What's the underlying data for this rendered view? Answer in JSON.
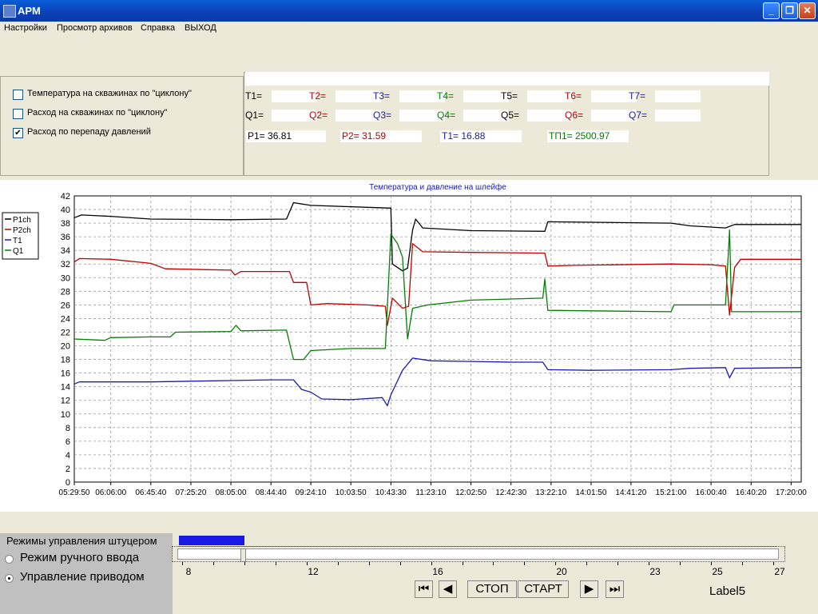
{
  "window": {
    "title": "APM",
    "icon": "app-icon",
    "controls": [
      "minimize-icon",
      "restore-icon",
      "close-icon"
    ]
  },
  "menu": [
    "Настройки",
    "Просмотр архивов",
    "Справка",
    "ВЫХОД"
  ],
  "checkboxes": [
    {
      "label": "Температура на скважинах по \"циклону\"",
      "checked": false
    },
    {
      "label": "Расход на скважинах по \"циклону\"",
      "checked": false
    },
    {
      "label": "Расход по перепаду давлений",
      "checked": true
    }
  ],
  "readings": {
    "row1": [
      {
        "label": "T1=",
        "value": "",
        "color": "#000000"
      },
      {
        "label": "T2=",
        "value": "",
        "color": "#c00000"
      },
      {
        "label": "T3=",
        "value": "",
        "color": "#1a1ab0"
      },
      {
        "label": "T4=",
        "value": "",
        "color": "#008000"
      },
      {
        "label": "T5=",
        "value": "",
        "color": "#000000"
      },
      {
        "label": "T6=",
        "value": "",
        "color": "#c00000"
      },
      {
        "label": "T7=",
        "value": "",
        "color": "#1a1ab0"
      }
    ],
    "row2": [
      {
        "label": "Q1=",
        "value": "",
        "color": "#000000"
      },
      {
        "label": "Q2=",
        "value": "",
        "color": "#c00000"
      },
      {
        "label": "Q3=",
        "value": "",
        "color": "#1a1ab0"
      },
      {
        "label": "Q4=",
        "value": "",
        "color": "#008000"
      },
      {
        "label": "Q5=",
        "value": "",
        "color": "#000000"
      },
      {
        "label": "Q6=",
        "value": "",
        "color": "#c00000"
      },
      {
        "label": "Q7=",
        "value": "",
        "color": "#1a1ab0"
      }
    ],
    "row3": [
      {
        "text": "P1= 36.81",
        "color": "#000000"
      },
      {
        "text": "P2= 31.59",
        "color": "#c00000"
      },
      {
        "text": "T1= 16.88",
        "color": "#1a1ab0"
      },
      {
        "text": "TП1= 2500.97",
        "color": "#008000"
      }
    ]
  },
  "chart_data": {
    "type": "line",
    "title": "Температура и давление на шлейфе",
    "ylim": [
      0,
      42
    ],
    "yticks": [
      0,
      2,
      4,
      6,
      8,
      10,
      12,
      14,
      16,
      18,
      20,
      22,
      24,
      26,
      28,
      30,
      32,
      34,
      36,
      38,
      40,
      42
    ],
    "xticks": [
      "05:29:50",
      "06:06:00",
      "06:45:40",
      "07:25:20",
      "08:05:00",
      "08:44:40",
      "09:24:10",
      "10:03:50",
      "10:43:30",
      "11:23:10",
      "12:02:50",
      "12:42:30",
      "13:22:10",
      "14:01:50",
      "14:41:20",
      "15:21:00",
      "16:00:40",
      "16:40:20",
      "17:20:00"
    ],
    "grid": true,
    "legend_position": "left",
    "series": [
      {
        "name": "P1ch",
        "color": "#000000",
        "points": [
          [
            "05:29:50",
            38.8
          ],
          [
            "05:37:00",
            39.2
          ],
          [
            "06:06:00",
            39.0
          ],
          [
            "06:45:40",
            38.6
          ],
          [
            "08:05:00",
            38.5
          ],
          [
            "09:00:00",
            38.6
          ],
          [
            "09:07:00",
            41.0
          ],
          [
            "09:24:10",
            40.6
          ],
          [
            "10:43:30",
            40.2
          ],
          [
            "10:45:00",
            32.0
          ],
          [
            "10:55:00",
            31.0
          ],
          [
            "11:00:00",
            31.4
          ],
          [
            "11:05:00",
            37.0
          ],
          [
            "11:08:00",
            38.6
          ],
          [
            "11:15:00",
            37.3
          ],
          [
            "12:02:50",
            36.9
          ],
          [
            "13:16:00",
            36.8
          ],
          [
            "13:19:00",
            38.2
          ],
          [
            "15:21:00",
            38.0
          ],
          [
            "15:40:00",
            37.6
          ],
          [
            "16:15:00",
            37.3
          ],
          [
            "16:24:00",
            37.8
          ],
          [
            "17:30:00",
            37.8
          ]
        ]
      },
      {
        "name": "P2ch",
        "color": "#c00000",
        "points": [
          [
            "05:29:50",
            32.3
          ],
          [
            "05:35:00",
            32.8
          ],
          [
            "06:06:00",
            32.7
          ],
          [
            "06:45:40",
            32.1
          ],
          [
            "07:00:00",
            31.3
          ],
          [
            "08:05:00",
            31.1
          ],
          [
            "08:09:00",
            30.4
          ],
          [
            "08:15:00",
            30.9
          ],
          [
            "09:03:00",
            30.9
          ],
          [
            "09:07:00",
            29.3
          ],
          [
            "09:20:00",
            29.3
          ],
          [
            "09:24:10",
            26.0
          ],
          [
            "09:40:00",
            26.2
          ],
          [
            "10:20:00",
            26.0
          ],
          [
            "10:38:00",
            25.8
          ],
          [
            "10:40:00",
            23.0
          ],
          [
            "10:45:00",
            27.0
          ],
          [
            "10:55:00",
            25.5
          ],
          [
            "11:01:00",
            25.8
          ],
          [
            "11:05:00",
            35.0
          ],
          [
            "11:15:00",
            33.8
          ],
          [
            "12:02:50",
            33.7
          ],
          [
            "13:16:00",
            33.6
          ],
          [
            "13:19:00",
            31.7
          ],
          [
            "13:45:00",
            31.8
          ],
          [
            "15:21:00",
            32.0
          ],
          [
            "16:00:00",
            31.9
          ],
          [
            "16:15:00",
            31.7
          ],
          [
            "16:19:00",
            24.5
          ],
          [
            "16:24:00",
            31.5
          ],
          [
            "16:30:00",
            32.7
          ],
          [
            "17:30:00",
            32.7
          ]
        ]
      },
      {
        "name": "T1",
        "color": "#1a1ab0",
        "points": [
          [
            "05:29:50",
            14.4
          ],
          [
            "05:35:00",
            14.7
          ],
          [
            "06:45:40",
            14.7
          ],
          [
            "07:25:20",
            14.8
          ],
          [
            "08:05:00",
            14.9
          ],
          [
            "08:44:40",
            15.0
          ],
          [
            "09:07:00",
            15.0
          ],
          [
            "09:15:00",
            13.6
          ],
          [
            "09:24:10",
            13.2
          ],
          [
            "09:35:00",
            12.2
          ],
          [
            "10:03:50",
            12.1
          ],
          [
            "10:35:00",
            12.4
          ],
          [
            "10:40:00",
            11.2
          ],
          [
            "10:43:30",
            12.8
          ],
          [
            "10:55:00",
            16.4
          ],
          [
            "11:05:00",
            18.2
          ],
          [
            "11:23:10",
            17.8
          ],
          [
            "12:02:50",
            17.7
          ],
          [
            "12:42:30",
            17.6
          ],
          [
            "13:14:00",
            17.6
          ],
          [
            "13:19:00",
            16.5
          ],
          [
            "14:01:50",
            16.4
          ],
          [
            "15:21:00",
            16.5
          ],
          [
            "15:40:00",
            16.7
          ],
          [
            "16:15:00",
            16.8
          ],
          [
            "16:19:00",
            15.3
          ],
          [
            "16:24:00",
            16.7
          ],
          [
            "17:30:00",
            16.8
          ]
        ]
      },
      {
        "name": "Q1",
        "color": "#008000",
        "points": [
          [
            "05:29:50",
            21.0
          ],
          [
            "06:00:00",
            20.8
          ],
          [
            "06:06:00",
            21.2
          ],
          [
            "06:45:40",
            21.3
          ],
          [
            "07:05:00",
            21.3
          ],
          [
            "07:10:00",
            22.0
          ],
          [
            "08:05:00",
            22.1
          ],
          [
            "08:10:00",
            23.0
          ],
          [
            "08:15:00",
            22.2
          ],
          [
            "09:00:00",
            22.3
          ],
          [
            "09:07:00",
            18.0
          ],
          [
            "09:17:00",
            18.0
          ],
          [
            "09:24:10",
            19.3
          ],
          [
            "10:03:50",
            19.6
          ],
          [
            "10:38:00",
            19.6
          ],
          [
            "10:43:30",
            36.4
          ],
          [
            "10:50:00",
            35.0
          ],
          [
            "10:55:00",
            33.0
          ],
          [
            "11:00:00",
            21.0
          ],
          [
            "11:05:00",
            25.5
          ],
          [
            "11:20:00",
            26.0
          ],
          [
            "12:02:50",
            26.7
          ],
          [
            "13:14:00",
            27.0
          ],
          [
            "13:16:00",
            29.8
          ],
          [
            "13:19:00",
            25.2
          ],
          [
            "15:21:00",
            25.0
          ],
          [
            "15:24:00",
            26.0
          ],
          [
            "16:15:00",
            26.0
          ],
          [
            "16:19:00",
            37.0
          ],
          [
            "16:21:00",
            25.0
          ],
          [
            "17:30:00",
            25.0
          ]
        ]
      }
    ]
  },
  "mode_panel": {
    "title": "Режимы управления штуцером",
    "options": [
      {
        "label": "Режим ручного ввода",
        "selected": false
      },
      {
        "label": "Управление приводом",
        "selected": true
      }
    ]
  },
  "progress": {
    "value_fraction": 0.11
  },
  "slider": {
    "min": 8,
    "max": 27,
    "value": 10,
    "tick_labels": [
      "8",
      "12",
      "16",
      "20",
      "23",
      "25",
      "27"
    ]
  },
  "controls": {
    "first_icon": "skip-first-icon",
    "prev_icon": "prev-icon",
    "stop_label": "СТОП",
    "start_label": "СТАРТ",
    "next_icon": "next-icon",
    "last_icon": "skip-last-icon"
  },
  "status_label": "Label5"
}
